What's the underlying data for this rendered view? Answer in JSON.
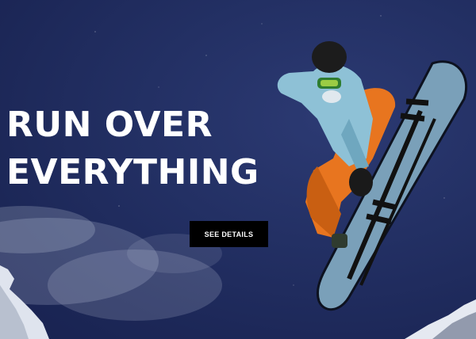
{
  "hero": {
    "headline_line1": "RUN OVER",
    "headline_line2": "EVERYTHING",
    "cta_label": "SEE DETAILS"
  },
  "colors": {
    "sky": "#1f2a55",
    "headline_text": "#ffffff",
    "cta_background": "#000000",
    "cta_text": "#ffffff",
    "jacket": "#8ec1d6",
    "pants": "#e8751f",
    "board": "#7aa0b9"
  }
}
